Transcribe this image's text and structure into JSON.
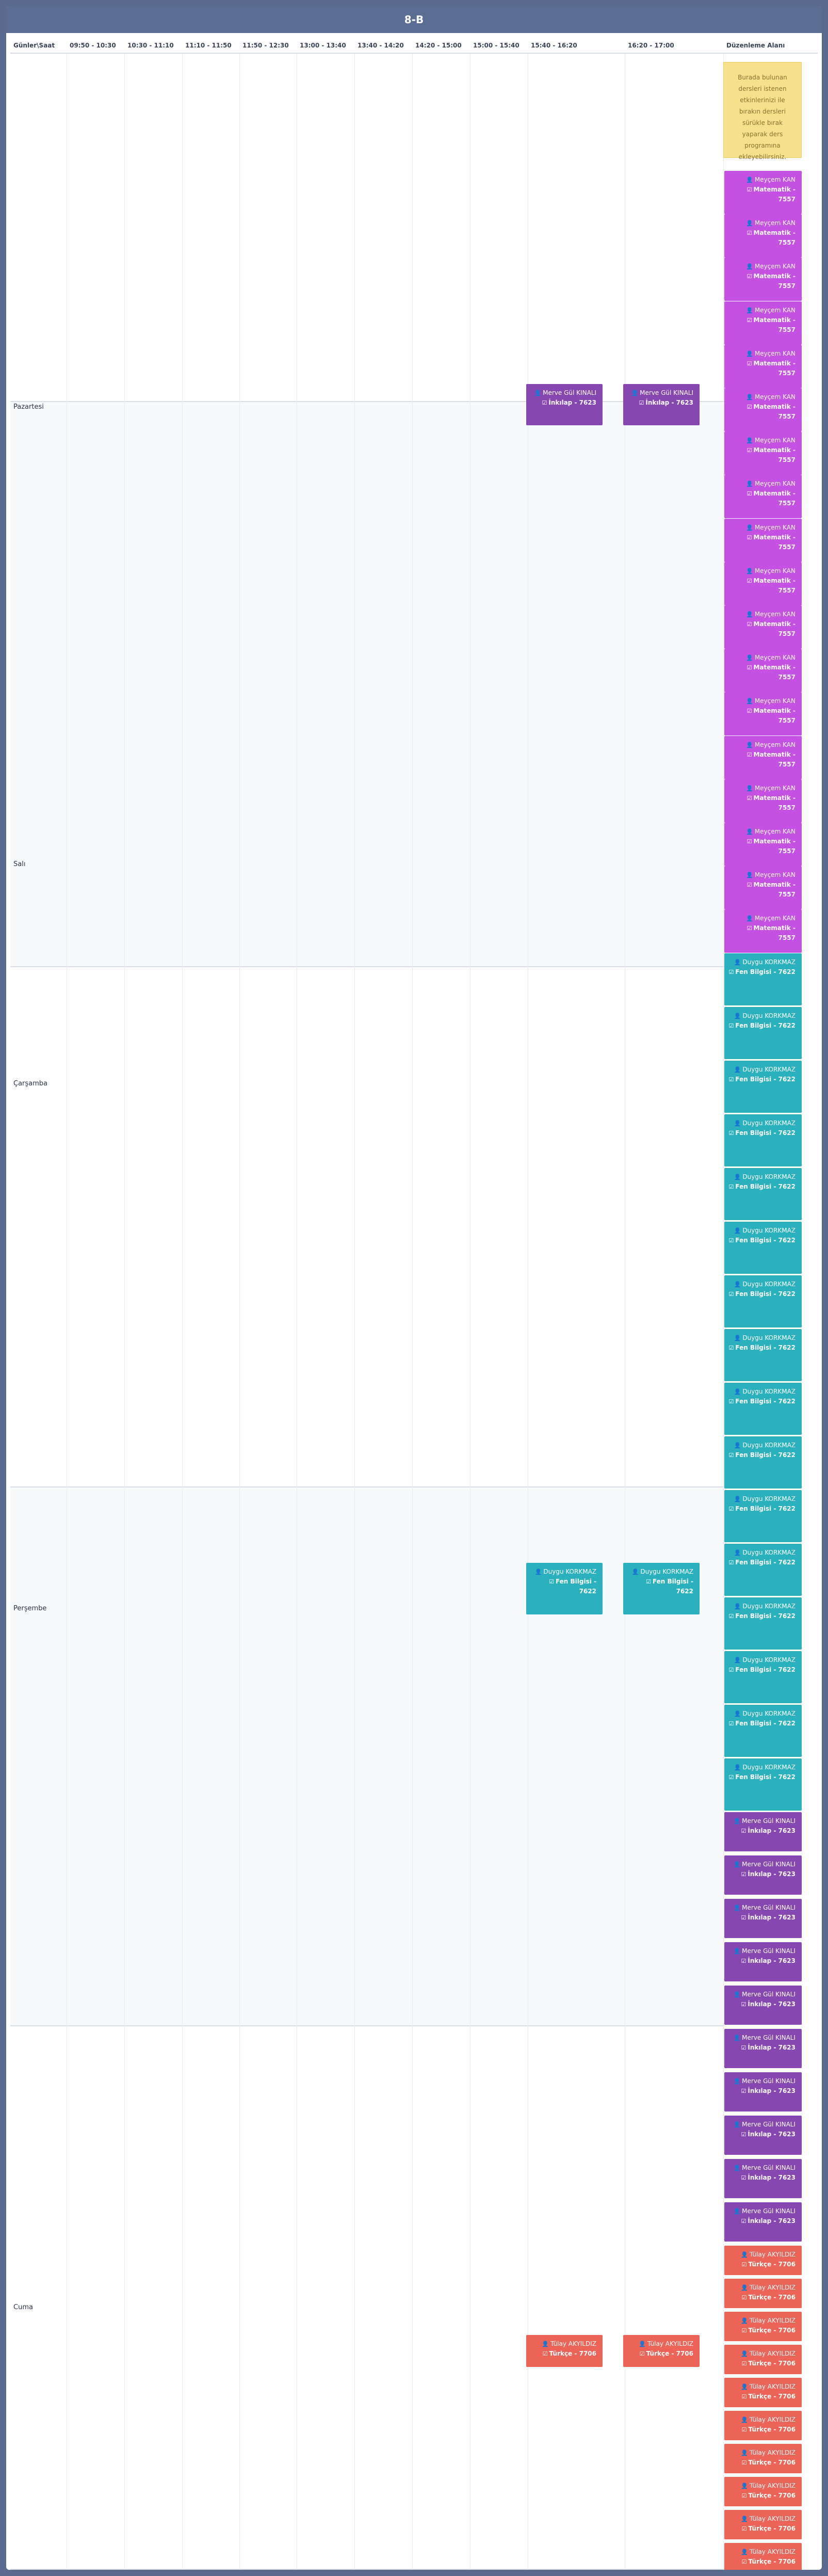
{
  "title": "8-B",
  "header": {
    "days_col": "Günler\\Saat",
    "times": [
      "09:50 - 10:30",
      "10:30 - 11:10",
      "11:10 - 11:50",
      "11:50 - 12:30",
      "13:00 - 13:40",
      "13:40 - 14:20",
      "14:20 - 15:00",
      "15:00 - 15:40",
      "15:40 - 16:20",
      "16:20 - 17:00"
    ],
    "edit_col": "Düzenleme Alanı"
  },
  "days": [
    "Pazartesi",
    "Salı",
    "Çarşamba",
    "Perşembe",
    "Cuma"
  ],
  "hint": "Burada bulunan dersleri istediğiniz sürükleyerek bırakın dersleri sürükle bırak yaparak ders programına ekleyebilirsiniz.",
  "hint_lines": [
    "Burada bulunan",
    "dersleri istenen",
    "etkinlerinizi ile",
    "bırakın dersleri",
    "sürükle bırak",
    "yaparak ders",
    "programına",
    "ekleyebilirsiniz."
  ],
  "icons": {
    "teacher": "user-icon",
    "lesson": "check-square-icon"
  },
  "colors": {
    "matematik": "#c451e2",
    "fen": "#2bb0bd",
    "inkilap": "#8747b1",
    "turkce": "#ec6357",
    "header": "#5c6d94",
    "hint": "#f6e08c"
  },
  "lessons": {
    "matematik": {
      "teacher": "Meyçem KAN",
      "subject": "Matematik - 7557"
    },
    "fen": {
      "teacher": "Duygu KORKMAZ",
      "subject": "Fen Bilgisi - 7622"
    },
    "inkilap": {
      "teacher": "Merve Gül KINALI",
      "subject": "İnkılap - 7623"
    },
    "turkce": {
      "teacher": "Tülay AKYILDIZ",
      "subject": "Türkçe - 7706"
    }
  },
  "scheduled": [
    {
      "day": "Pazartesi",
      "slot": "15:40 - 16:20",
      "lesson": "inkilap"
    },
    {
      "day": "Pazartesi",
      "slot": "16:20 - 17:00",
      "lesson": "inkilap"
    },
    {
      "day": "Perşembe",
      "slot": "15:40 - 16:20",
      "lesson": "fen"
    },
    {
      "day": "Perşembe",
      "slot": "16:20 - 17:00",
      "lesson": "fen"
    },
    {
      "day": "Cuma",
      "slot": "15:40 - 16:20",
      "lesson": "turkce"
    },
    {
      "day": "Cuma",
      "slot": "16:20 - 17:00",
      "lesson": "turkce"
    }
  ],
  "pool_counts": {
    "matematik": 18,
    "fen": 16,
    "inkilap": 10,
    "turkce": 10
  }
}
